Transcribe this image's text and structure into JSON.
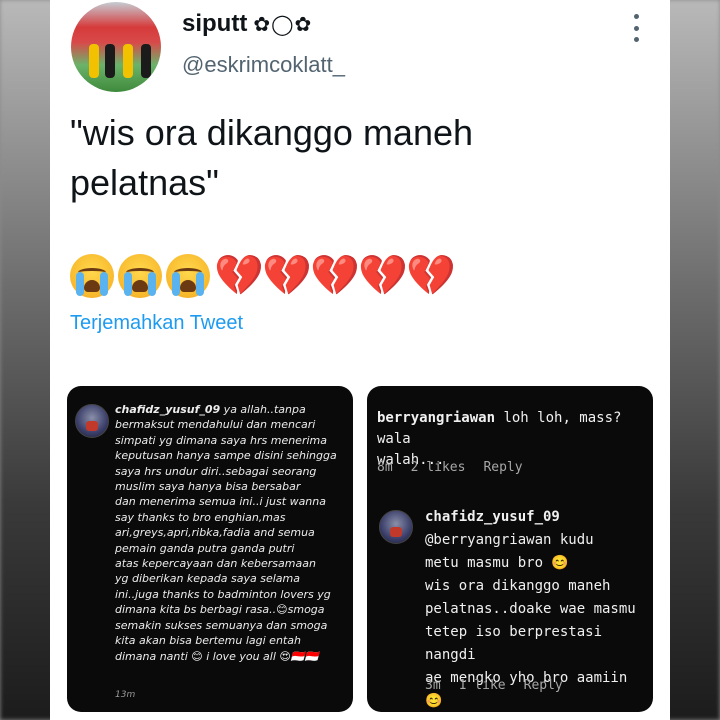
{
  "tweet": {
    "author_name": "siputt",
    "author_deco": "✿◯✿",
    "handle": "@eskrimcoklatt_",
    "text": "\"wis ora dikanggo maneh\npelatnas\"",
    "emojis": [
      "loudly-crying-face",
      "loudly-crying-face",
      "loudly-crying-face",
      "broken-heart",
      "broken-heart",
      "broken-heart",
      "broken-heart",
      "broken-heart"
    ],
    "translate_label": "Terjemahkan Tweet"
  },
  "screenshot_left": {
    "username": "chafidz_yusuf_09",
    "text": " ya allah..tanpa\nbermaksut mendahului dan mencari\nsimpati yg dimana saya hrs menerima\nkeputusan hanya sampe disini sehingga\nsaya hrs undur diri..sebagai seorang\nmuslim saya hanya bisa bersabar\ndan menerima semua ini..i just wanna\nsay thanks to bro enghian,mas\nari,greys,apri,ribka,fadia and semua\npemain ganda putra ganda putri\natas kepercayaan dan kebersamaan\nyg diberikan kepada saya selama\nini..juga thanks to badminton lovers yg\ndimana kita bs berbagi rasa..😊smoga\nsemakin sukses semuanya dan smoga\nkita akan bisa bertemu lagi entah\ndimana nanti 😊 i love you all 😍🇮🇩🇮🇩",
    "time": "13m"
  },
  "screenshot_right": {
    "comment_username": "berryangriawan",
    "comment_text": " loh loh, mass? wala\nwalah...",
    "comment_time": "8m",
    "comment_likes": "2 likes",
    "comment_reply": "Reply",
    "reply_username": "chafidz_yusuf_09",
    "reply_text": "\n@berryangriawan kudu\nmetu masmu bro 😊\nwis ora dikanggo maneh\npelatnas..doake wae masmu\ntetep iso berprestasi nangdi\nae mengko yho bro aamiin 😊",
    "reply_time": "3m",
    "reply_likes": "1 like",
    "reply_reply": "Reply"
  }
}
